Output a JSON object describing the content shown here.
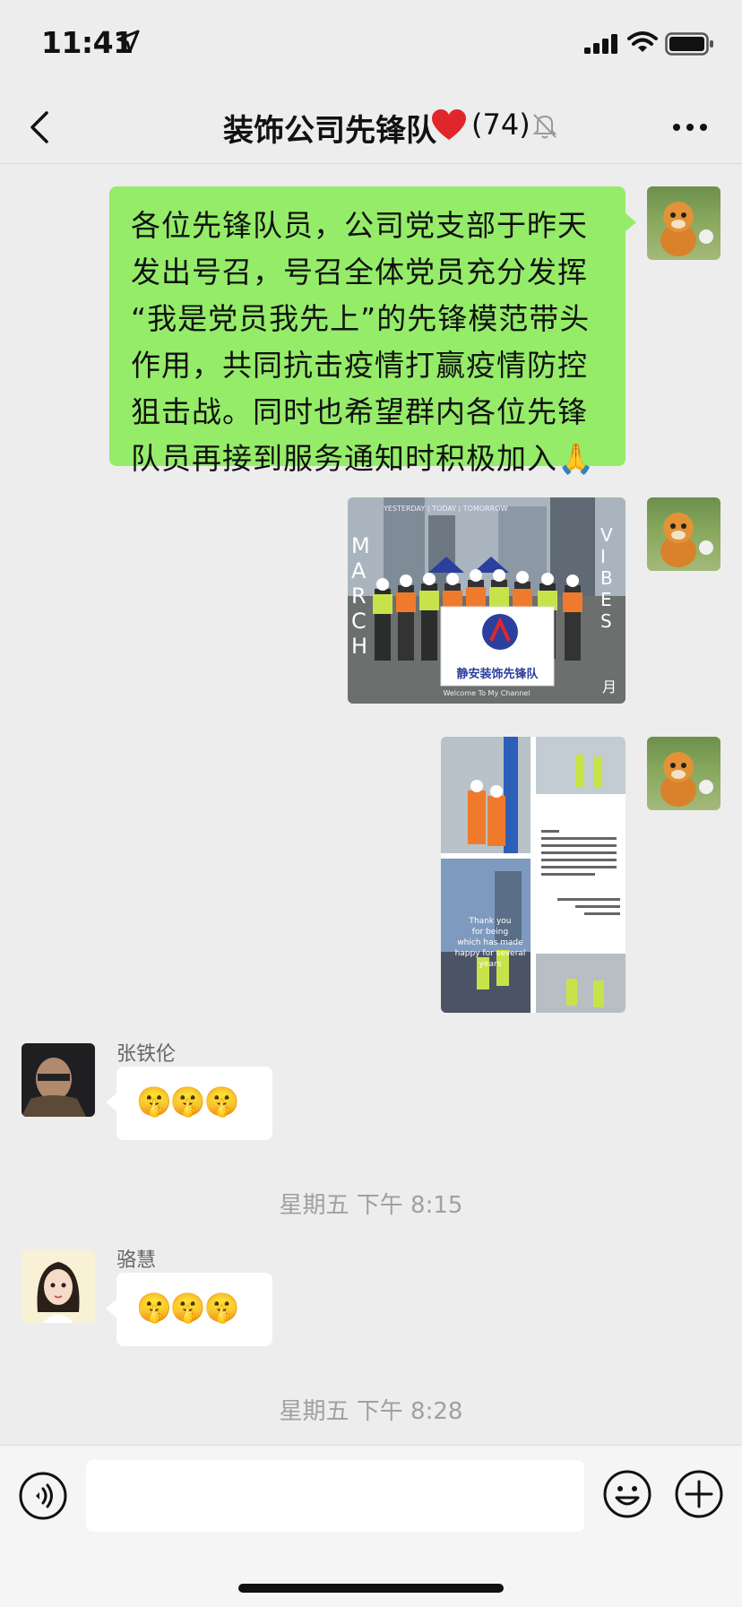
{
  "status_bar": {
    "time": "11:41"
  },
  "header": {
    "back_icon": "chevron-left-icon",
    "title": "装饰公司先锋队",
    "heart": "❤️",
    "count": "(74)",
    "mute_icon": "bell-slash-icon",
    "more_icon": "ellipsis-icon"
  },
  "messages": [
    {
      "sender": "self",
      "type": "text",
      "lines": [
        "各位先锋队员，公司党支部于昨天",
        "发出号召，号召全体党员充分发挥",
        "“我是党员我先上”的先锋模范带头",
        "作用，共同抗击疫情打赢疫情防控",
        "狙击战。同时也希望群内各位先锋",
        "队员再接到服务通知时积极加入"
      ],
      "end_emoji": "🙏"
    },
    {
      "sender": "self",
      "type": "image",
      "banner_text": "静安装饰先锋队",
      "caption_top": "YESTERDAY | TODAY | TOMORROW",
      "caption_left": "MARCH",
      "caption_right": "VIBES",
      "caption_bottom": "Welcome To My Channel",
      "corner_char": "月"
    },
    {
      "sender": "self",
      "type": "image",
      "overlay_text": [
        "Thank you",
        "for being",
        "which has made",
        "happy for several",
        "years"
      ]
    },
    {
      "sender": "张铁伦",
      "type": "emoji",
      "emojis": "🤫🤫🤫"
    },
    {
      "type": "timestamp",
      "text": "星期五 下午 8:15"
    },
    {
      "sender": "骆慧",
      "type": "emoji",
      "emojis": "🤫🤫🤫"
    },
    {
      "type": "timestamp",
      "text": "星期五 下午 8:28"
    }
  ],
  "input_bar": {
    "voice_icon": "voice-icon",
    "emoji_icon": "smiley-icon",
    "plus_icon": "plus-circle-icon",
    "placeholder": ""
  }
}
